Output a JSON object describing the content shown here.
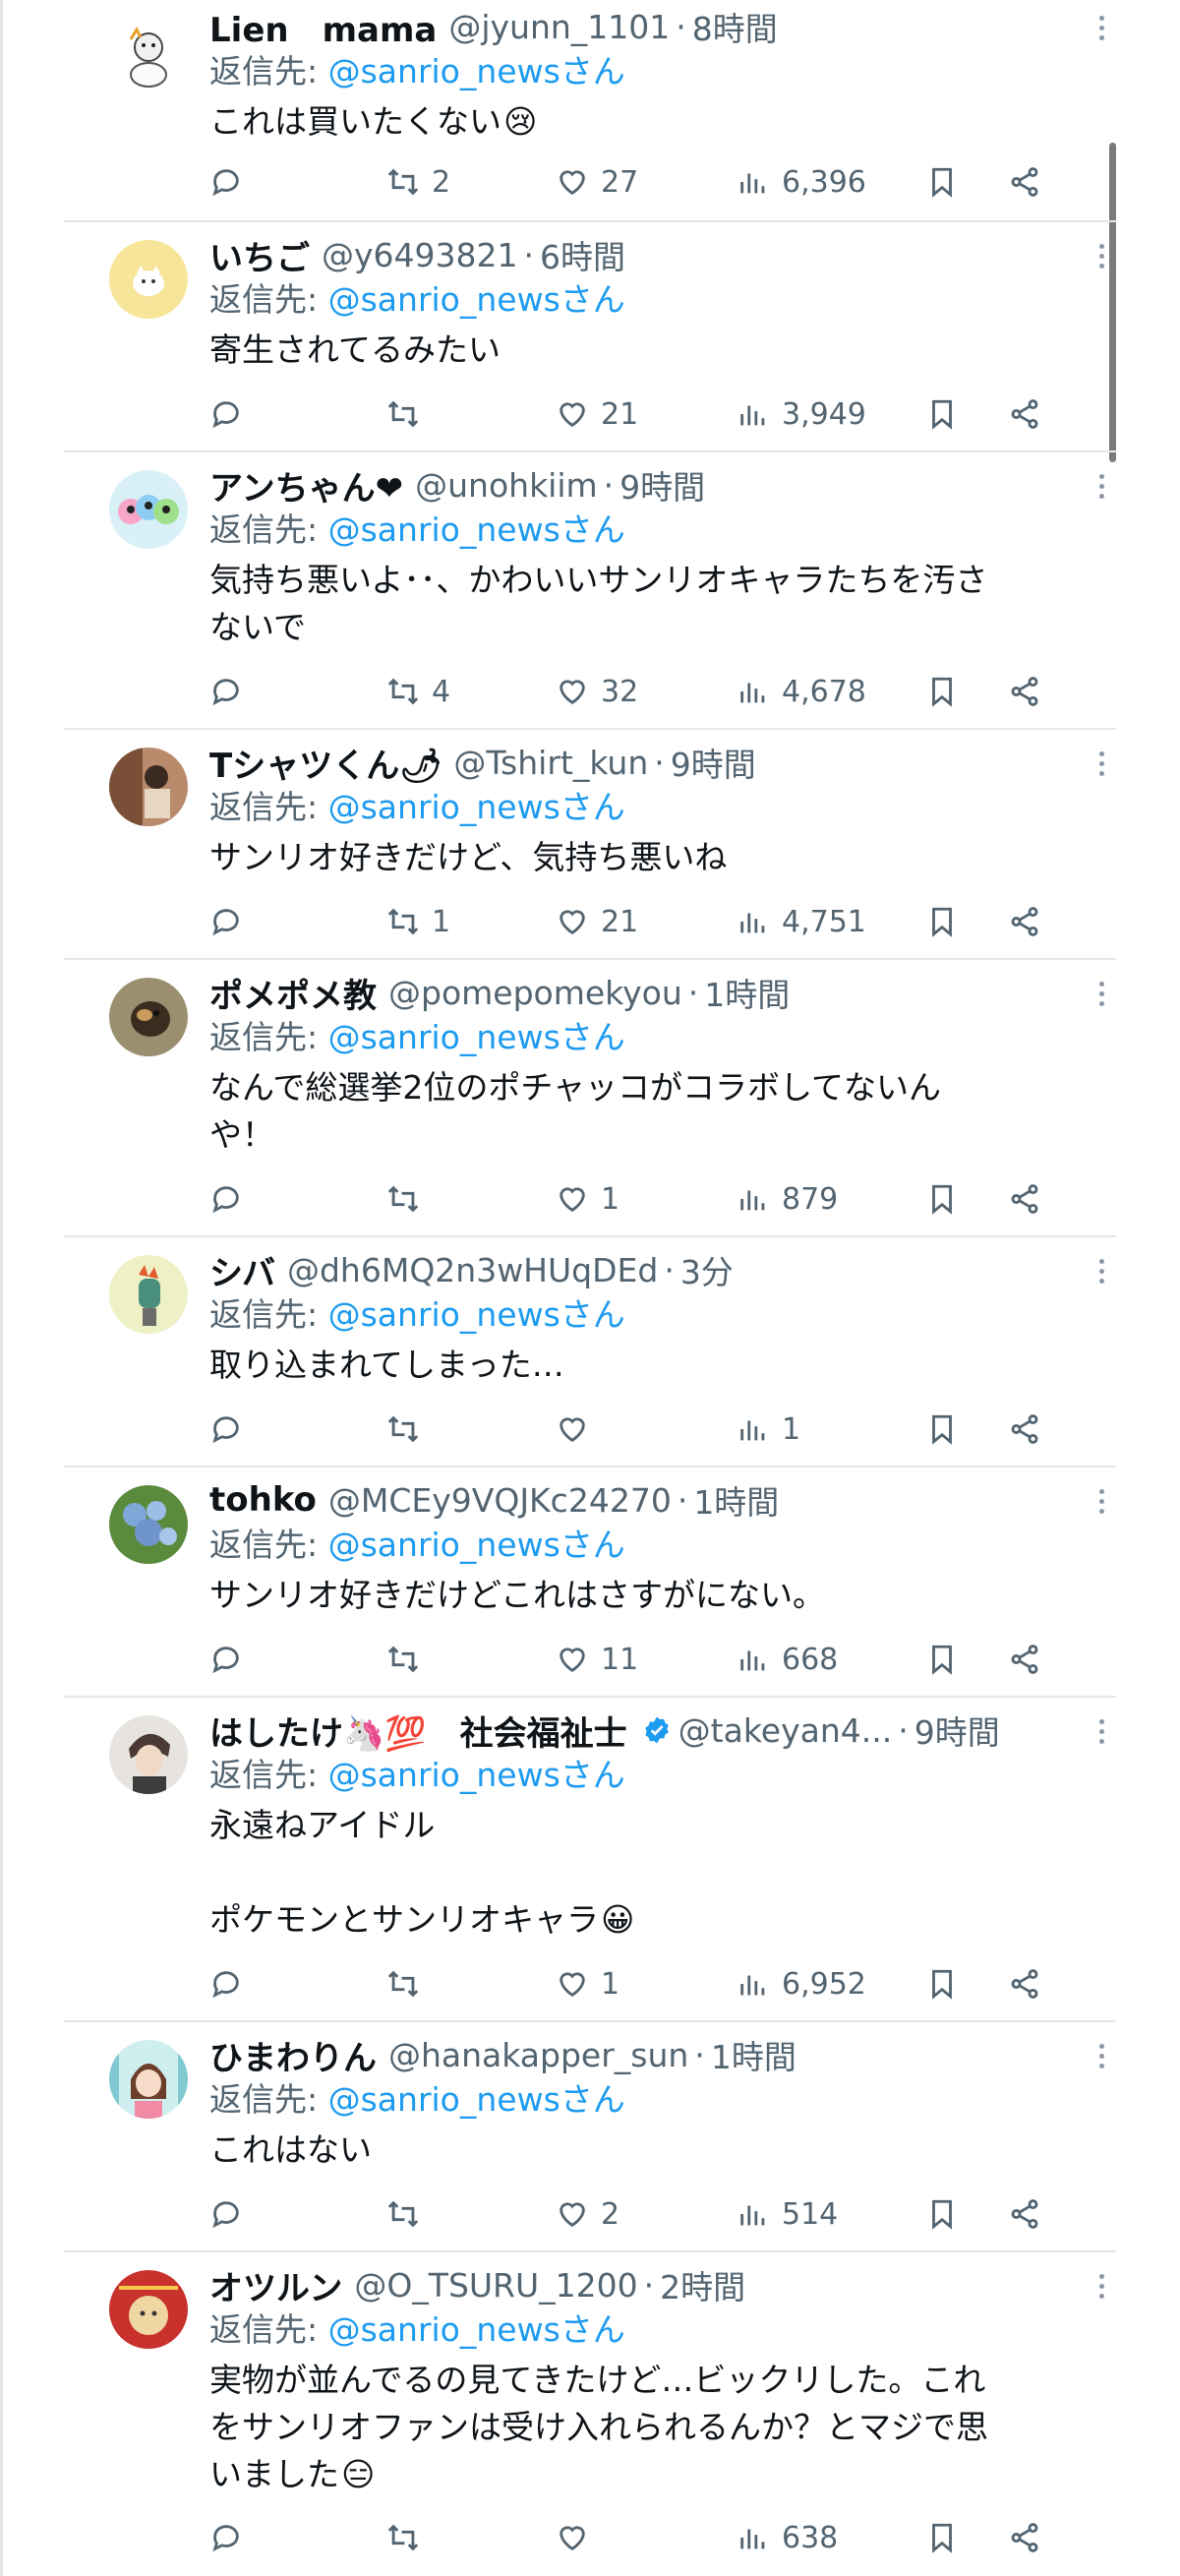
{
  "reply_prefix": "返信先: ",
  "reply_suffix": "さん",
  "reply_mention": "@sanrio_news",
  "colors": {
    "accent": "#1d9bf0",
    "muted": "#536471",
    "verified": "#1d9bf0"
  },
  "icons": [
    "reply-icon",
    "retweet-icon",
    "like-icon",
    "views-icon",
    "bookmark-icon",
    "share-icon",
    "more-icon",
    "verified-icon"
  ],
  "tweets": [
    {
      "name": "Lien　mama",
      "handle": "@jyunn_1101",
      "dot": "·",
      "time": "8時間",
      "text": "これは買いたくない",
      "emoji": "😢",
      "retweets": "2",
      "likes": "27",
      "views": "6,396"
    },
    {
      "name": "いちご",
      "handle": "@y6493821",
      "dot": "·",
      "time": "6時間",
      "text": "寄生されてるみたい",
      "retweets": "",
      "likes": "21",
      "views": "3,949"
    },
    {
      "name": "アンちゃん❤",
      "handle": "@unohkiim",
      "dot": "·",
      "time": "9時間",
      "text": "気持ち悪いよ･･、かわいいサンリオキャラたちを汚さ\nないで",
      "retweets": "4",
      "likes": "32",
      "views": "4,678"
    },
    {
      "name": "Tシャツくん🌶",
      "handle": "@Tshirt_kun",
      "dot": "·",
      "time": "9時間",
      "text": "サンリオ好きだけど、気持ち悪いね",
      "retweets": "1",
      "likes": "21",
      "views": "4,751"
    },
    {
      "name": "ポメポメ教",
      "handle": "@pomepomekyou",
      "dot": "·",
      "time": "1時間",
      "text": "なんで総選挙2位のポチャッコがコラボしてないん\nや！",
      "retweets": "",
      "likes": "1",
      "views": "879"
    },
    {
      "name": "シバ",
      "handle": "@dh6MQ2n3wHUqDEd",
      "dot": "·",
      "time": "3分",
      "text": "取り込まれてしまった…",
      "retweets": "",
      "likes": "",
      "views": "1"
    },
    {
      "name": "tohko",
      "handle": "@MCEy9VQJKc24270",
      "dot": "·",
      "time": "1時間",
      "text": "サンリオ好きだけどこれはさすがにない。",
      "retweets": "",
      "likes": "11",
      "views": "668"
    },
    {
      "name": "はしたけ🦄💯　社会福祉士",
      "handle": "@takeyan4...",
      "dot": "·",
      "time": "9時間",
      "text": "永遠ねアイドル\n\nポケモンとサンリオキャラ",
      "emoji": "😀",
      "retweets": "",
      "likes": "1",
      "views": "6,952"
    },
    {
      "name": "ひまわりん",
      "handle": "@hanakapper_sun",
      "dot": "·",
      "time": "1時間",
      "text": "これはない",
      "retweets": "",
      "likes": "2",
      "views": "514"
    },
    {
      "name": "オツルン",
      "handle": "@O_TSURU_1200",
      "dot": "·",
      "time": "2時間",
      "text": "実物が並んでるの見てきたけど…ビックリした。これ\nをサンリオファンは受け入れられるんか？とマジで思\nいました",
      "emoji": "😑",
      "retweets": "",
      "likes": "",
      "views": "638"
    }
  ]
}
